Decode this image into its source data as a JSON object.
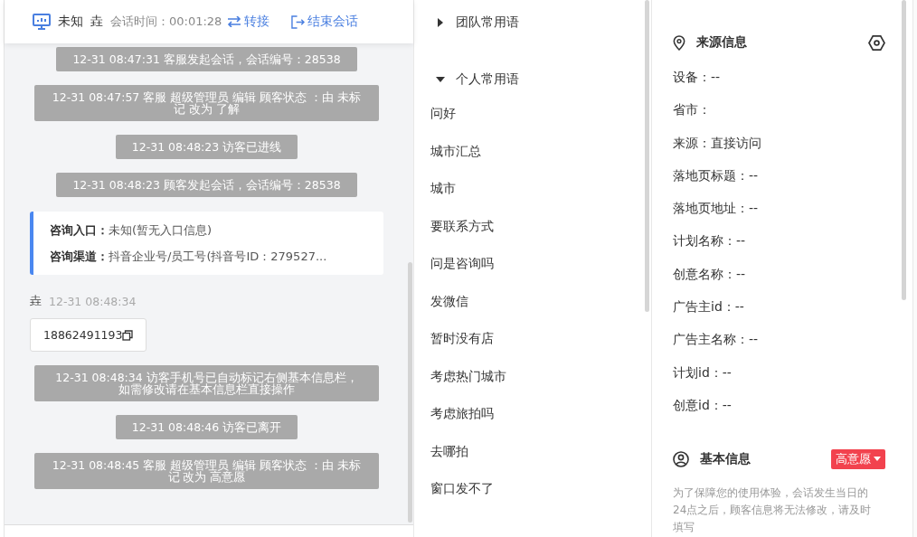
{
  "header": {
    "device_label": "未知",
    "visitor": "垚",
    "session_time": "会话时间：00:01:28",
    "transfer": "转接",
    "end": "结束会话"
  },
  "messages": [
    {
      "kind": "system",
      "text": "12-31 08:47:31 客服发起会话，会话编号：28538"
    },
    {
      "kind": "system",
      "text": "12-31 08:47:57 客服 超级管理员 编辑 顾客状态 ：由 未标记 改为 了解"
    },
    {
      "kind": "system",
      "text": "12-31 08:48:23 访客已进线"
    },
    {
      "kind": "system",
      "text": "12-31 08:48:23 顾客发起会话，会话编号：28538"
    },
    {
      "kind": "info",
      "lines": [
        {
          "label": "咨询入口：",
          "value": "未知(暂无入口信息)"
        },
        {
          "label": "咨询渠道：",
          "value": "抖音企业号/员工号(抖音号ID：279527..."
        }
      ]
    },
    {
      "kind": "visitor",
      "name": "垚",
      "time": "12-31 08:48:34",
      "text": "18862491193"
    },
    {
      "kind": "system",
      "text": "12-31 08:48:34 访客手机号已自动标记右侧基本信息栏，如需修改请在基本信息栏直接操作"
    },
    {
      "kind": "system",
      "text": "12-31 08:48:46 访客已离开"
    },
    {
      "kind": "system",
      "text": "12-31 08:48:45 客服 超级管理员 编辑 顾客状态 ：由 未标记 改为 高意愿"
    }
  ],
  "quick_replies": [
    {
      "label": "团队常用语",
      "expanded": false
    },
    {
      "label": "个人常用语",
      "expanded": true,
      "children": [
        "问好",
        "城市汇总",
        "城市",
        "要联系方式",
        "问是咨询吗",
        "发微信",
        "暂时没有店",
        "考虑热门城市",
        "考虑旅拍吗",
        "去哪拍",
        "窗口发不了"
      ]
    }
  ],
  "source_info": {
    "title": "来源信息",
    "fields": [
      "设备：--",
      "省市：",
      "来源：直接访问",
      "落地页标题：--",
      "落地页地址：--",
      "计划名称：--",
      "创意名称：--",
      "广告主id：--",
      "广告主名称：--",
      "计划id：--",
      "创意id：--"
    ]
  },
  "basic_info": {
    "title": "基本信息",
    "tag": "高意愿",
    "note": "为了保障您的使用体验，会话发生当日的24点之后，顾客信息将无法修改，请及时填写"
  }
}
